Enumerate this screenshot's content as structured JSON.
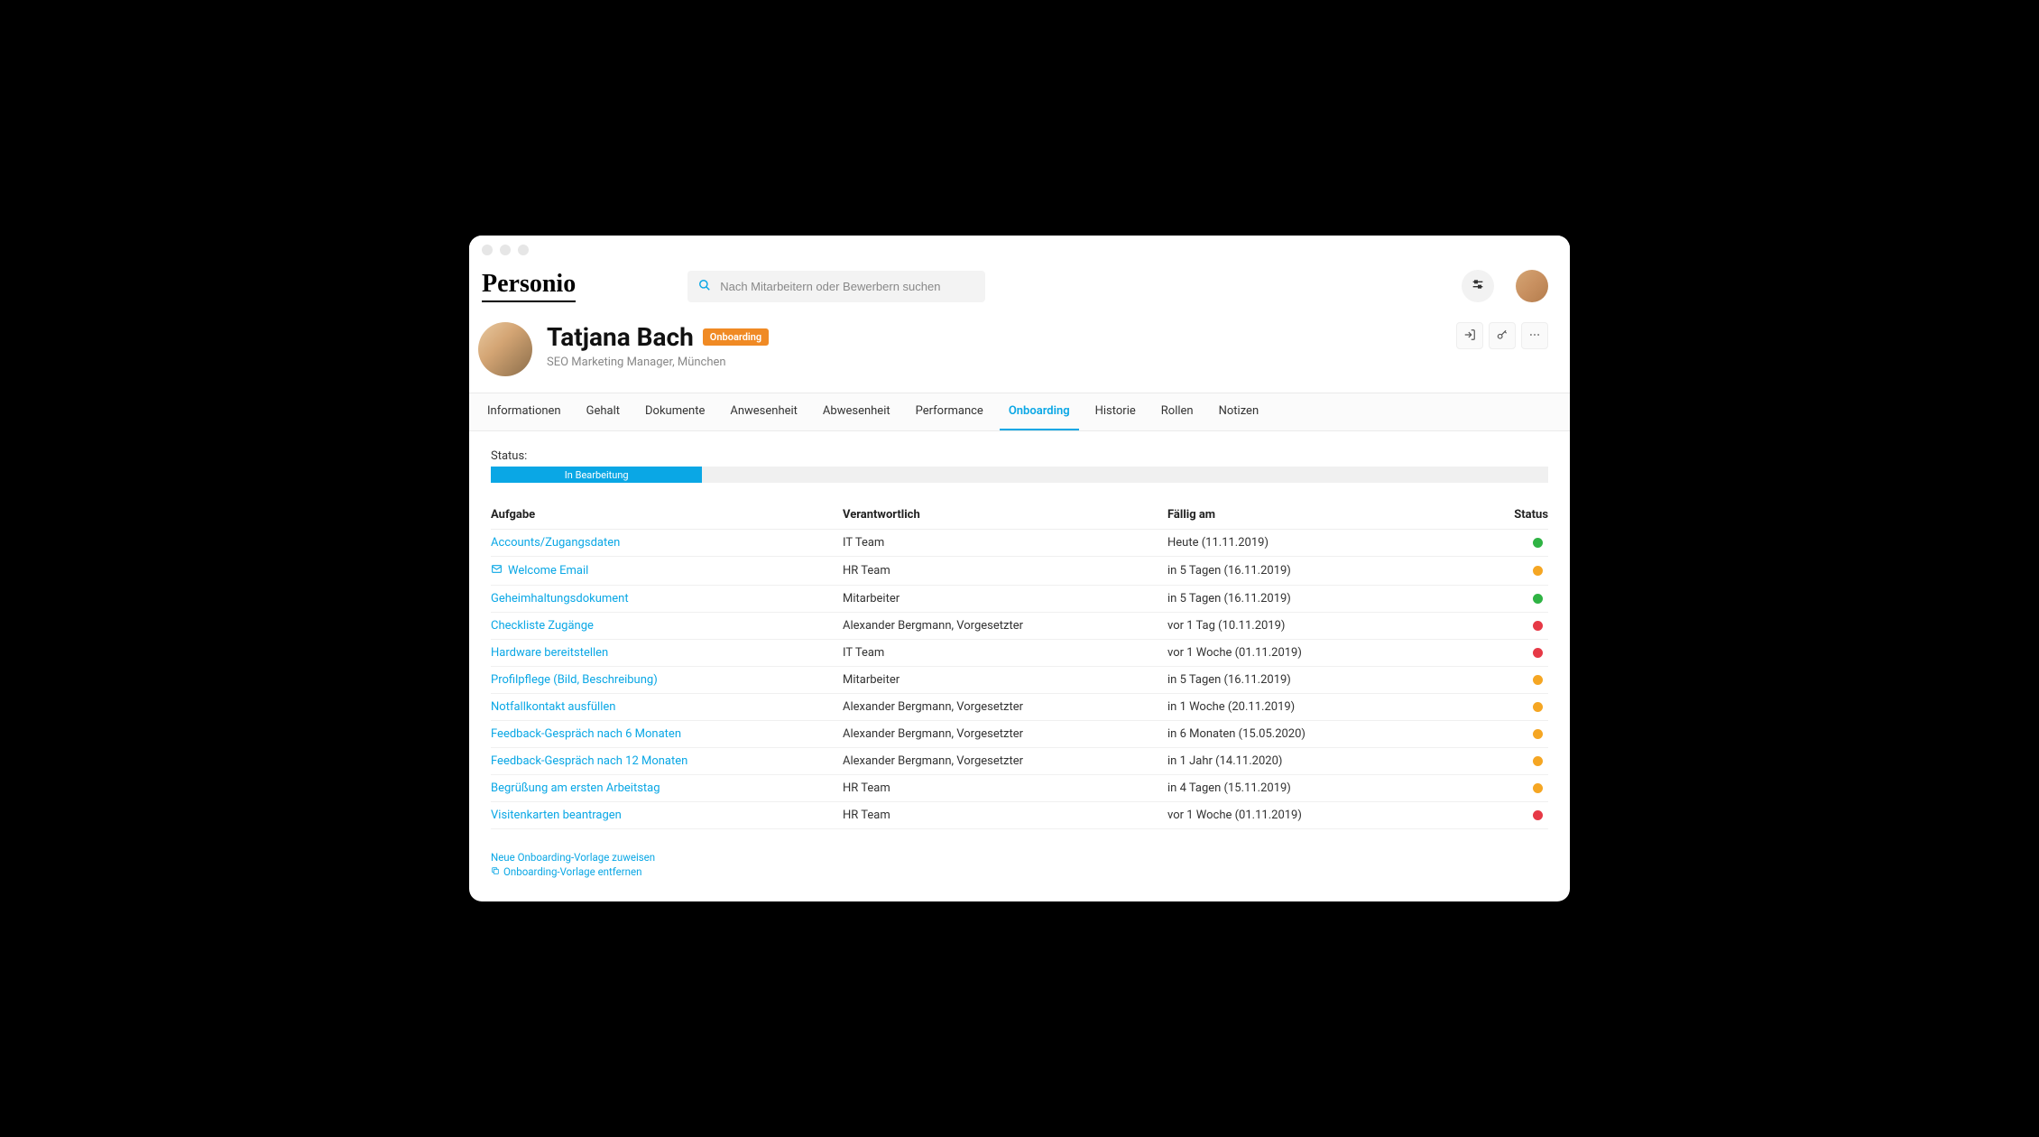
{
  "brand": "Personio",
  "search": {
    "placeholder": "Nach Mitarbeitern oder Bewerbern suchen"
  },
  "profile": {
    "name": "Tatjana Bach",
    "badge": "Onboarding",
    "subtitle": "SEO Marketing Manager, München"
  },
  "tabs": [
    {
      "label": "Informationen",
      "active": false
    },
    {
      "label": "Gehalt",
      "active": false
    },
    {
      "label": "Dokumente",
      "active": false
    },
    {
      "label": "Anwesenheit",
      "active": false
    },
    {
      "label": "Abwesenheit",
      "active": false
    },
    {
      "label": "Performance",
      "active": false
    },
    {
      "label": "Onboarding",
      "active": true
    },
    {
      "label": "Historie",
      "active": false
    },
    {
      "label": "Rollen",
      "active": false
    },
    {
      "label": "Notizen",
      "active": false
    }
  ],
  "status": {
    "label": "Status:",
    "text": "In Bearbeitung"
  },
  "columns": {
    "task": "Aufgabe",
    "responsible": "Verantwortlich",
    "due": "Fällig am",
    "status": "Status"
  },
  "status_colors": {
    "green": "#2fb344",
    "orange": "#f5a623",
    "red": "#e63946"
  },
  "tasks": [
    {
      "title": "Accounts/Zugangsdaten",
      "icon": false,
      "responsible": "IT Team",
      "due": "Heute (11.11.2019)",
      "status": "green"
    },
    {
      "title": "Welcome Email",
      "icon": true,
      "responsible": "HR Team",
      "due": "in 5 Tagen (16.11.2019)",
      "status": "orange"
    },
    {
      "title": "Geheimhaltungsdokument",
      "icon": false,
      "responsible": "Mitarbeiter",
      "due": "in 5 Tagen (16.11.2019)",
      "status": "green"
    },
    {
      "title": "Checkliste Zugänge",
      "icon": false,
      "responsible": "Alexander Bergmann, Vorgesetzter",
      "due": "vor 1 Tag (10.11.2019)",
      "status": "red"
    },
    {
      "title": "Hardware bereitstellen",
      "icon": false,
      "responsible": "IT Team",
      "due": "vor 1 Woche (01.11.2019)",
      "status": "red"
    },
    {
      "title": "Profilpflege (Bild, Beschreibung)",
      "icon": false,
      "responsible": "Mitarbeiter",
      "due": "in 5 Tagen (16.11.2019)",
      "status": "orange"
    },
    {
      "title": "Notfallkontakt ausfüllen",
      "icon": false,
      "responsible": "Alexander Bergmann, Vorgesetzter",
      "due": "in 1 Woche (20.11.2019)",
      "status": "orange"
    },
    {
      "title": "Feedback-Gespräch nach 6 Monaten",
      "icon": false,
      "responsible": "Alexander Bergmann, Vorgesetzter",
      "due": "in 6 Monaten (15.05.2020)",
      "status": "orange"
    },
    {
      "title": "Feedback-Gespräch nach 12 Monaten",
      "icon": false,
      "responsible": "Alexander Bergmann, Vorgesetzter",
      "due": "in 1 Jahr (14.11.2020)",
      "status": "orange"
    },
    {
      "title": "Begrüßung am ersten Arbeitstag",
      "icon": false,
      "responsible": "HR Team",
      "due": "in 4 Tagen (15.11.2019)",
      "status": "orange"
    },
    {
      "title": "Visitenkarten beantragen",
      "icon": false,
      "responsible": "HR Team",
      "due": "vor 1 Woche (01.11.2019)",
      "status": "red"
    }
  ],
  "footer": {
    "assign": "Neue Onboarding-Vorlage zuweisen",
    "remove": "Onboarding-Vorlage entfernen"
  }
}
